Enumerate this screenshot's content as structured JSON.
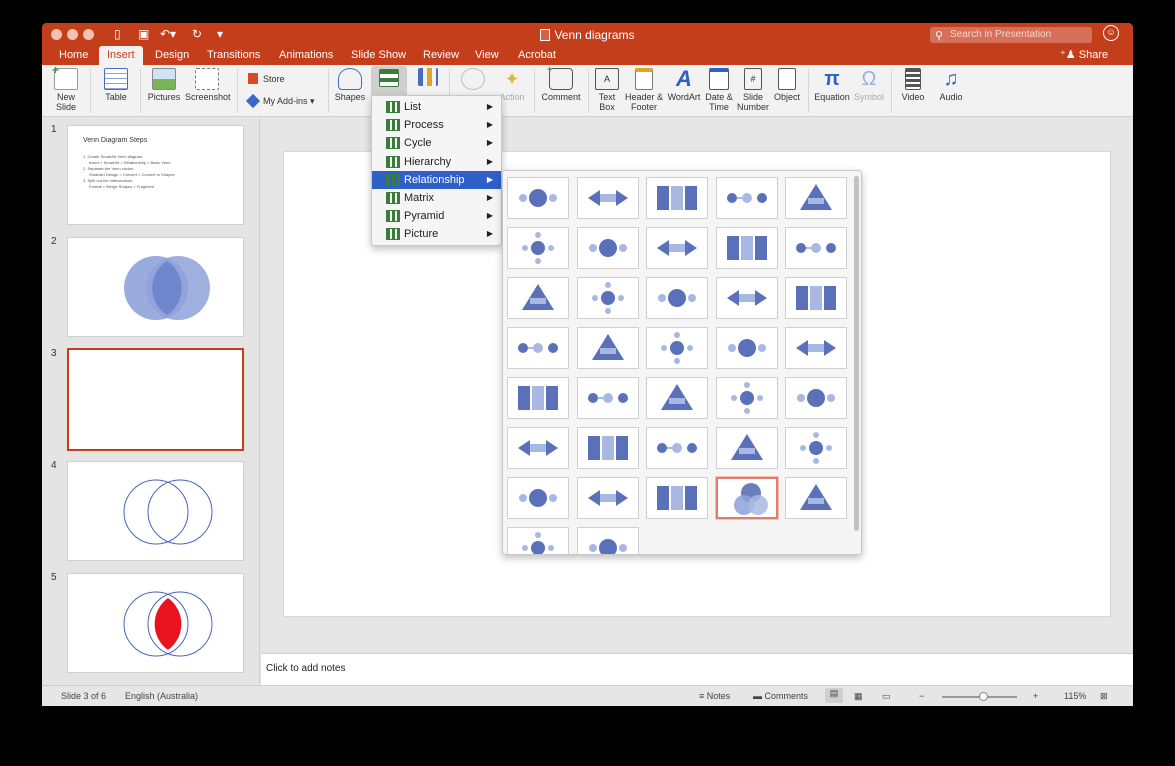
{
  "window": {
    "title": "Venn diagrams",
    "search_placeholder": "Search in Presentation",
    "share_label": "Share"
  },
  "tabs": [
    "Home",
    "Insert",
    "Design",
    "Transitions",
    "Animations",
    "Slide Show",
    "Review",
    "View",
    "Acrobat"
  ],
  "active_tab": "Insert",
  "ribbon": {
    "new_slide": "New\nSlide",
    "table": "Table",
    "pictures": "Pictures",
    "screenshot": "Screenshot",
    "store": "Store",
    "my_addins": "My Add-ins",
    "shapes": "Shapes",
    "action": "Action",
    "comment": "Comment",
    "text_box": "Text\nBox",
    "header_footer": "Header &\nFooter",
    "wordart": "WordArt",
    "date_time": "Date &\nTime",
    "slide_number": "Slide\nNumber",
    "object": "Object",
    "equation": "Equation",
    "symbol": "Symbol",
    "video": "Video",
    "audio": "Audio"
  },
  "smartart_menu": [
    {
      "label": "List",
      "icon": "list-icon",
      "color": "#3a7d3a"
    },
    {
      "label": "Process",
      "icon": "process-icon",
      "color": "#3a7d3a"
    },
    {
      "label": "Cycle",
      "icon": "cycle-icon",
      "color": "#3a7d3a"
    },
    {
      "label": "Hierarchy",
      "icon": "hierarchy-icon",
      "color": "#3a7d3a"
    },
    {
      "label": "Relationship",
      "icon": "relationship-icon",
      "color": "#3a7d3a"
    },
    {
      "label": "Matrix",
      "icon": "matrix-icon",
      "color": "#3a7d3a"
    },
    {
      "label": "Pyramid",
      "icon": "pyramid-icon",
      "color": "#3a7d3a"
    },
    {
      "label": "Picture",
      "icon": "picture-icon",
      "color": "#3a7d3a"
    }
  ],
  "smartart_highlighted": "Relationship",
  "gallery": {
    "item_count": 37,
    "selected_index": 33,
    "selected_name": "Basic Venn"
  },
  "slides": [
    {
      "number": "1",
      "title": "Venn Diagram Steps",
      "steps": [
        "1.  Create SmartArt Venn diagram:",
        "Insert > SmartArt > Relationship > Basic Venn",
        "2.  Separate the Venn circles:",
        "SmartArt Design > Convert > Convert to Shapes",
        "3.  Split out the intersections:",
        "Format > Merge Shapes > Fragment"
      ]
    },
    {
      "number": "2"
    },
    {
      "number": "3"
    },
    {
      "number": "4"
    },
    {
      "number": "5"
    }
  ],
  "notes_placeholder": "Click to add notes",
  "status": {
    "slide_info": "Slide 3 of 6",
    "language": "English (Australia)",
    "notes": "Notes",
    "comments": "Comments",
    "zoom": "115%",
    "zoom_level": 0.55
  },
  "colors": {
    "accent": "#c43e1c",
    "venn_fill": "#8ea2db",
    "venn_stroke": "#4a64b8",
    "highlight_red": "#e8131e",
    "menu_highlight": "#2f5fc9"
  }
}
